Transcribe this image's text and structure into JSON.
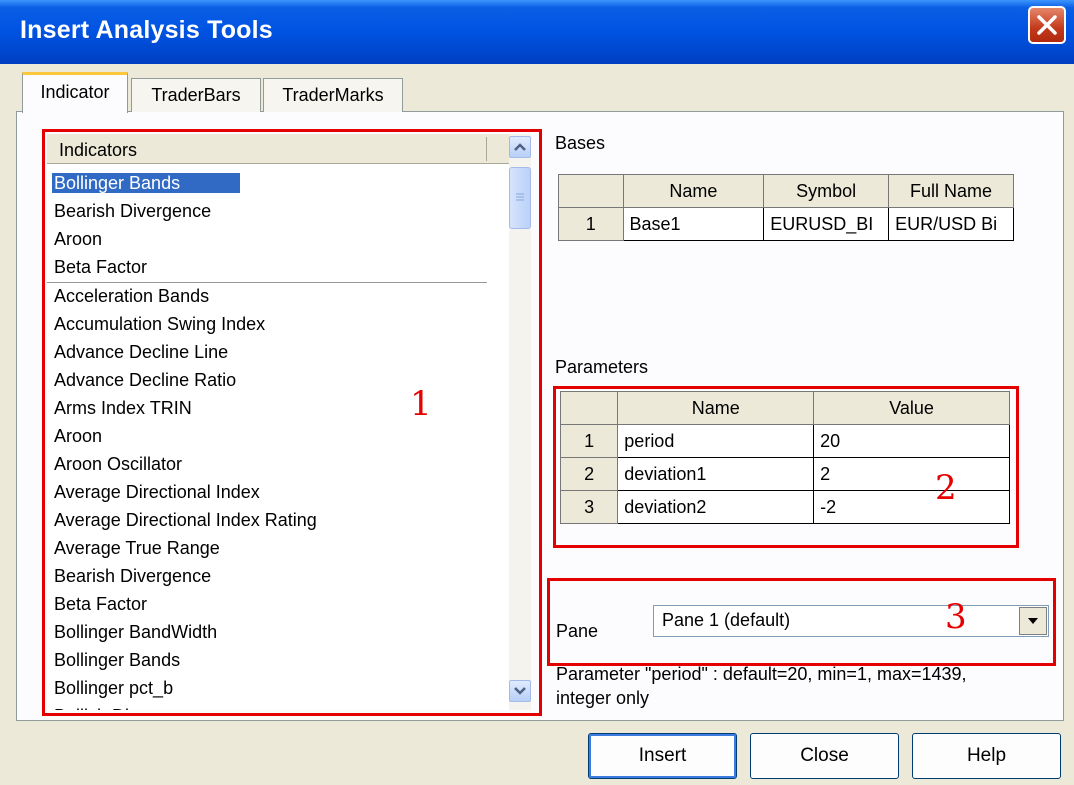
{
  "window": {
    "title": "Insert Analysis Tools"
  },
  "tabs": [
    {
      "label": "Indicator",
      "active": true
    },
    {
      "label": "TraderBars",
      "active": false
    },
    {
      "label": "TraderMarks",
      "active": false
    }
  ],
  "indicators": {
    "header": "Indicators",
    "recent": [
      "Bollinger Bands",
      "Bearish Divergence",
      "Aroon",
      "Beta Factor"
    ],
    "selected": "Bollinger Bands",
    "items": [
      "Acceleration Bands",
      "Accumulation Swing Index",
      "Advance Decline Line",
      "Advance Decline Ratio",
      "Arms Index TRIN",
      "Aroon",
      "Aroon Oscillator",
      "Average Directional Index",
      "Average Directional Index Rating",
      "Average True Range",
      "Bearish Divergence",
      "Beta Factor",
      "Bollinger BandWidth",
      "Bollinger Bands",
      "Bollinger pct_b",
      "Bullish Divergence"
    ]
  },
  "bases": {
    "label": "Bases",
    "columns": [
      "Name",
      "Symbol",
      "Full Name"
    ],
    "rows": [
      {
        "num": "1",
        "name": "Base1",
        "symbol": "EURUSD_BI",
        "full_name": "EUR/USD Bi"
      }
    ]
  },
  "parameters": {
    "label": "Parameters",
    "columns": [
      "Name",
      "Value"
    ],
    "rows": [
      {
        "num": "1",
        "name": "period",
        "value": "20"
      },
      {
        "num": "2",
        "name": "deviation1",
        "value": "2"
      },
      {
        "num": "3",
        "name": "deviation2",
        "value": "-2"
      }
    ]
  },
  "pane": {
    "label": "Pane",
    "value": "Pane 1 (default)"
  },
  "hint": {
    "line1": "Parameter \"period\" : default=20, min=1, max=1439,",
    "line2": "integer only"
  },
  "annotations": {
    "one": "1",
    "two": "2",
    "three": "3",
    "color": "#e40000"
  },
  "buttons": {
    "insert": "Insert",
    "close": "Close",
    "help": "Help"
  },
  "colors": {
    "titlebar": "#0054e3",
    "selection": "#316ac5",
    "dialog_bg": "#ece9d8"
  }
}
